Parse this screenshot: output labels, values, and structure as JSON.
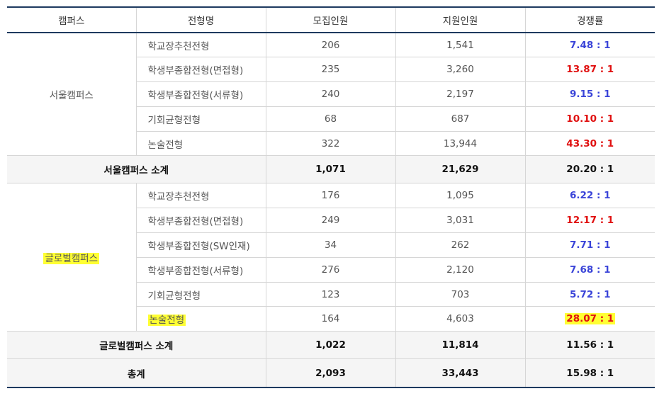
{
  "header": [
    "캠퍼스",
    "전형명",
    "모집인원",
    "지원인원",
    "경쟁률"
  ],
  "colors": {
    "header_border": "#1e3a5f",
    "rate_low": "#3a44d8",
    "rate_high": "#e01010",
    "summary_bg": "#f5f5f5",
    "highlight": "#ffff33"
  },
  "seoul": {
    "campus": "서울캠퍼스",
    "rows": [
      {
        "track": "학교장추천전형",
        "quota": "206",
        "applicants": "1,541",
        "rate": "7.48 : 1",
        "rate_color": "blue"
      },
      {
        "track": "학생부종합전형(면접형)",
        "quota": "235",
        "applicants": "3,260",
        "rate": "13.87 : 1",
        "rate_color": "red"
      },
      {
        "track": "학생부종합전형(서류형)",
        "quota": "240",
        "applicants": "2,197",
        "rate": "9.15 : 1",
        "rate_color": "blue"
      },
      {
        "track": "기회균형전형",
        "quota": "68",
        "applicants": "687",
        "rate": "10.10 : 1",
        "rate_color": "red"
      },
      {
        "track": "논술전형",
        "quota": "322",
        "applicants": "13,944",
        "rate": "43.30 : 1",
        "rate_color": "red"
      }
    ],
    "subtotal": {
      "label": "서울캠퍼스 소계",
      "quota": "1,071",
      "applicants": "21,629",
      "rate": "20.20 : 1"
    }
  },
  "global": {
    "campus": "글로벌캠퍼스",
    "rows": [
      {
        "track": "학교장추천전형",
        "quota": "176",
        "applicants": "1,095",
        "rate": "6.22 : 1",
        "rate_color": "blue"
      },
      {
        "track": "학생부종합전형(면접형)",
        "quota": "249",
        "applicants": "3,031",
        "rate": "12.17 : 1",
        "rate_color": "red"
      },
      {
        "track": "학생부종합전형(SW인재)",
        "quota": "34",
        "applicants": "262",
        "rate": "7.71 : 1",
        "rate_color": "blue"
      },
      {
        "track": "학생부종합전형(서류형)",
        "quota": "276",
        "applicants": "2,120",
        "rate": "7.68 : 1",
        "rate_color": "blue"
      },
      {
        "track": "기회균형전형",
        "quota": "123",
        "applicants": "703",
        "rate": "5.72 : 1",
        "rate_color": "blue"
      },
      {
        "track": "논술전형",
        "quota": "164",
        "applicants": "4,603",
        "rate": "28.07 : 1",
        "rate_color": "red"
      }
    ],
    "subtotal": {
      "label": "글로벌캠퍼스 소계",
      "quota": "1,022",
      "applicants": "11,814",
      "rate": "11.56 : 1"
    }
  },
  "total": {
    "label": "총계",
    "quota": "2,093",
    "applicants": "33,443",
    "rate": "15.98 : 1"
  }
}
